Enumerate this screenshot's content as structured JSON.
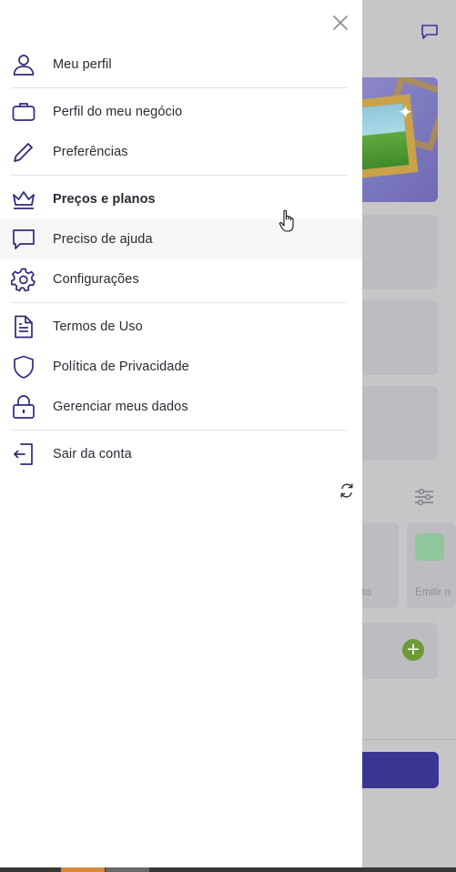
{
  "colors": {
    "accent": "#3c3693",
    "icon": "#2f2a7a",
    "text": "#2a2a35",
    "overlay": "#c6c6c9",
    "divider": "#e3e3e6"
  },
  "background": {
    "tile_labels": [
      "to",
      "Emitir n"
    ]
  },
  "drawer": {
    "close_icon": "close-icon",
    "items": [
      {
        "label": "Meu perfil",
        "icon": "user-icon"
      },
      {
        "label": "Perfil do meu negócio",
        "icon": "briefcase-icon"
      },
      {
        "label": "Preferências",
        "icon": "pencil-icon"
      },
      {
        "label": "Preços e planos",
        "icon": "crown-icon"
      },
      {
        "label": "Preciso de ajuda",
        "icon": "chat-icon"
      },
      {
        "label": "Configurações",
        "icon": "gear-icon"
      },
      {
        "label": "Termos de Uso",
        "icon": "document-icon"
      },
      {
        "label": "Política de Privacidade",
        "icon": "shield-icon"
      },
      {
        "label": "Gerenciar meus dados",
        "icon": "lock-icon"
      },
      {
        "label": "Sair da conta",
        "icon": "logout-icon"
      }
    ]
  }
}
